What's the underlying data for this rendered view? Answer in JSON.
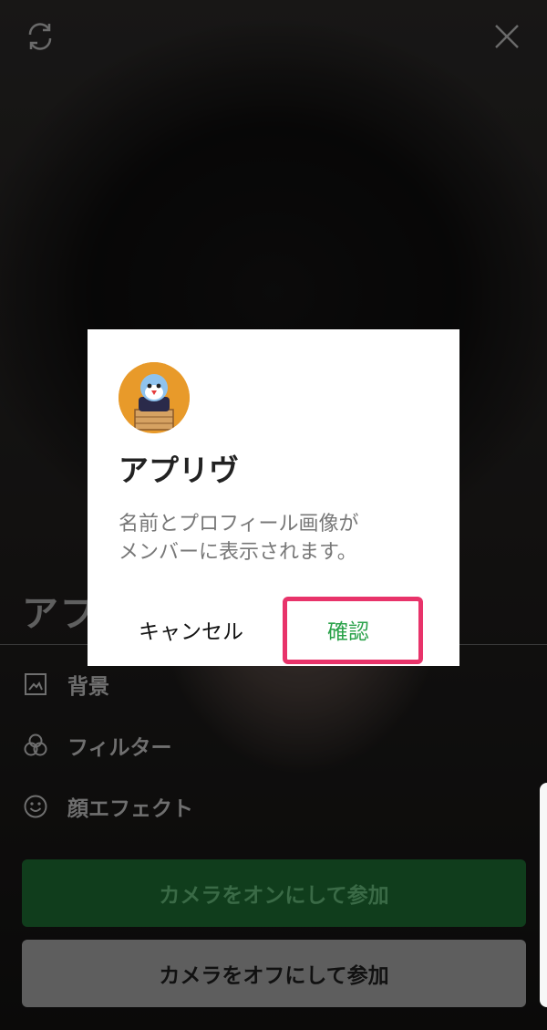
{
  "screen": {
    "options": [
      {
        "icon": "image-icon",
        "label": "背景"
      },
      {
        "icon": "filter-icon",
        "label": "フィルター"
      },
      {
        "icon": "face-effect-icon",
        "label": "顔エフェクト"
      }
    ],
    "name_preview": "アプリヴ",
    "join_camera_on_label": "カメラをオンにして参加",
    "join_camera_off_label": "カメラをオフにして参加"
  },
  "dialog": {
    "title": "アプリヴ",
    "message_line1": "名前とプロフィール画像が",
    "message_line2": "メンバーに表示されます。",
    "cancel_label": "キャンセル",
    "confirm_label": "確認"
  },
  "colors": {
    "confirm_text": "#2aa24a",
    "highlight_border": "#e8336a",
    "join_on_bg": "#103d1c"
  }
}
